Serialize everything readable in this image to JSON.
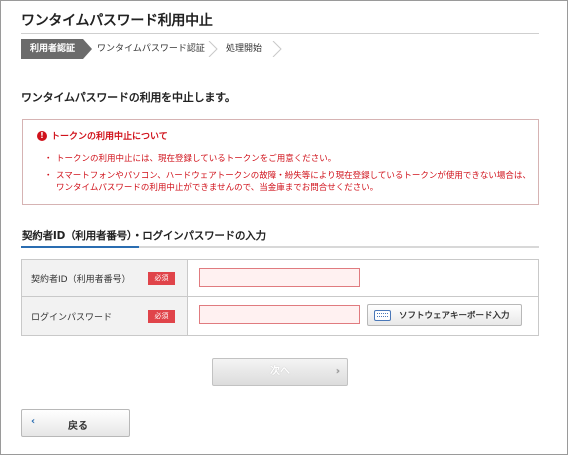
{
  "page": {
    "title": "ワンタイムパスワード利用中止",
    "lead": "ワンタイムパスワードの利用を中止します。"
  },
  "steps": [
    {
      "label": "利用者認証",
      "state": "current"
    },
    {
      "label": "ワンタイムパスワード認証",
      "state": "pending"
    },
    {
      "label": "処理開始",
      "state": "pending"
    }
  ],
  "notice": {
    "icon": "exclamation-circle-icon",
    "heading": "トークンの利用中止について",
    "items": [
      "トークンの利用中止には、現在登録しているトークンをご用意ください。",
      "スマートフォンやパソコン、ハードウェアトークンの故障・紛失等により現在登録しているトークンが使用できない場合は、ワンタイムパスワードの利用中止ができませんので、当金庫までお問合せください。"
    ],
    "bullet": "・",
    "color": "#d0121b"
  },
  "section": {
    "title": "契約者ID（利用者番号）・ログインパスワードの入力",
    "accent_color": "#2a6db1"
  },
  "form": {
    "contract_id": {
      "label": "契約者ID（利用者番号）",
      "required_badge": "必須",
      "value": "",
      "placeholder": ""
    },
    "password": {
      "label": "ログインパスワード",
      "required_badge": "必須",
      "value": "",
      "placeholder": ""
    },
    "keyboard_button": {
      "label": "ソフトウェアキーボード入力",
      "icon": "keyboard-icon"
    }
  },
  "buttons": {
    "next": {
      "label": "次へ",
      "icon": "chevron-right-icon",
      "chevron": "›"
    },
    "back": {
      "label": "戻る",
      "icon": "chevron-left-icon",
      "chevron": "‹"
    }
  }
}
